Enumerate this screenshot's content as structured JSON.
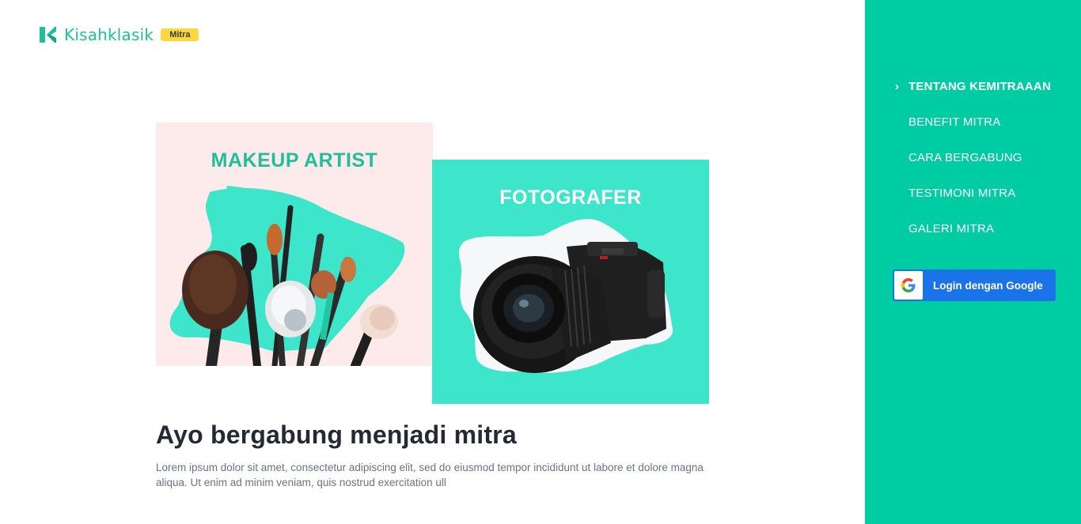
{
  "brand": {
    "name": "Kisahklasik",
    "badge": "Mitra",
    "colors": {
      "primary": "#00cca4",
      "logo": "#1fbf9c",
      "badge": "#f9d93d"
    }
  },
  "cards": {
    "makeup": {
      "title": "MAKEUP ARTIST"
    },
    "photo": {
      "title": "FOTOGRAFER"
    }
  },
  "hero": {
    "headline": "Ayo bergabung menjadi mitra",
    "description": "Lorem ipsum dolor sit amet, consectetur adipiscing elit, sed do eiusmod tempor incididunt ut labore et dolore magna aliqua. Ut enim ad minim veniam, quis nostrud exercitation ull"
  },
  "sidebar": {
    "nav": [
      {
        "label": "TENTANG KEMITRAAAN",
        "active": true
      },
      {
        "label": "BENEFIT MITRA",
        "active": false
      },
      {
        "label": "CARA BERGABUNG",
        "active": false
      },
      {
        "label": "TESTIMONI MITRA",
        "active": false
      },
      {
        "label": "GALERI MITRA",
        "active": false
      }
    ],
    "login_label": "Login dengan Google"
  }
}
